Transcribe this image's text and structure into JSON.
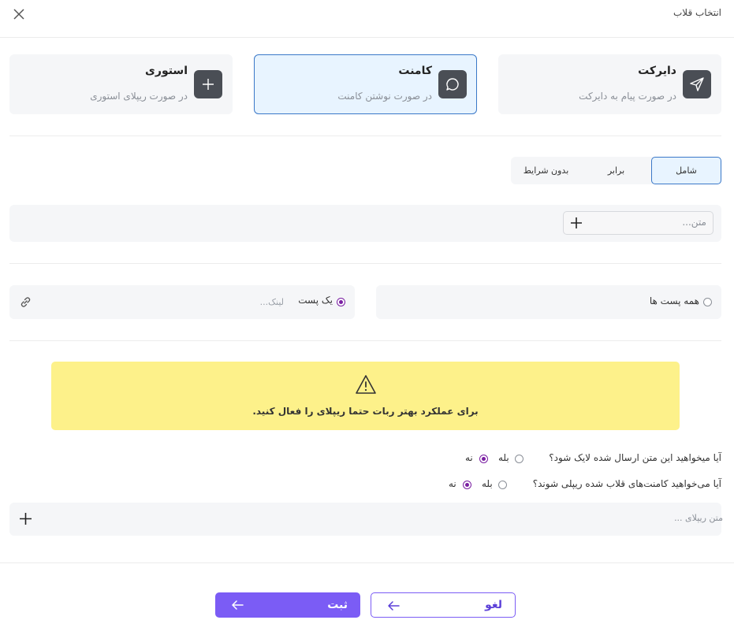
{
  "header": {
    "title": "انتخاب قلاب"
  },
  "types": [
    {
      "title": "دایرکت",
      "subtitle": "در صورت پیام به دایرکت",
      "icon": "send-icon"
    },
    {
      "title": "کامنت",
      "subtitle": "در صورت نوشتن کامنت",
      "icon": "comment-icon"
    },
    {
      "title": "استوری",
      "subtitle": "در صورت ریپلای استوری",
      "icon": "plus-icon"
    }
  ],
  "active_type": "کامنت",
  "condition_tabs": [
    {
      "label": "شامل"
    },
    {
      "label": "برابر"
    },
    {
      "label": "بدون شرایط"
    }
  ],
  "active_tab": "شامل",
  "keyword": {
    "placeholder": "متن...",
    "value": ""
  },
  "posts": {
    "all_label": "همه پست ها",
    "one_label": "یک پست",
    "link_placeholder": "لینک...",
    "selected": "یک پست"
  },
  "warning": {
    "text": "برای عملکرد بهتر ربات حتما ریپلای را فعال کنید.",
    "icon": "warning-triangle-icon"
  },
  "questions": [
    {
      "text": "آیا میخواهید این متن ارسال شده لایک شود؟",
      "yes": "بله",
      "no": "نه",
      "selected": "نه"
    },
    {
      "text": "آیا می‌خواهید کامنت‌های قلاب شده ریپلی شوند؟",
      "yes": "بله",
      "no": "نه",
      "selected": "نه"
    }
  ],
  "reply": {
    "placeholder": "متن ریپلای ..."
  },
  "footer": {
    "submit_label": "ثبت",
    "cancel_label": "لغو"
  },
  "colors": {
    "primary": "#7b5cf5",
    "active_border": "#3a78c8",
    "active_bg": "#e8f4ff",
    "warning_bg": "#fdf18a",
    "radio": "#7a1fa2"
  }
}
